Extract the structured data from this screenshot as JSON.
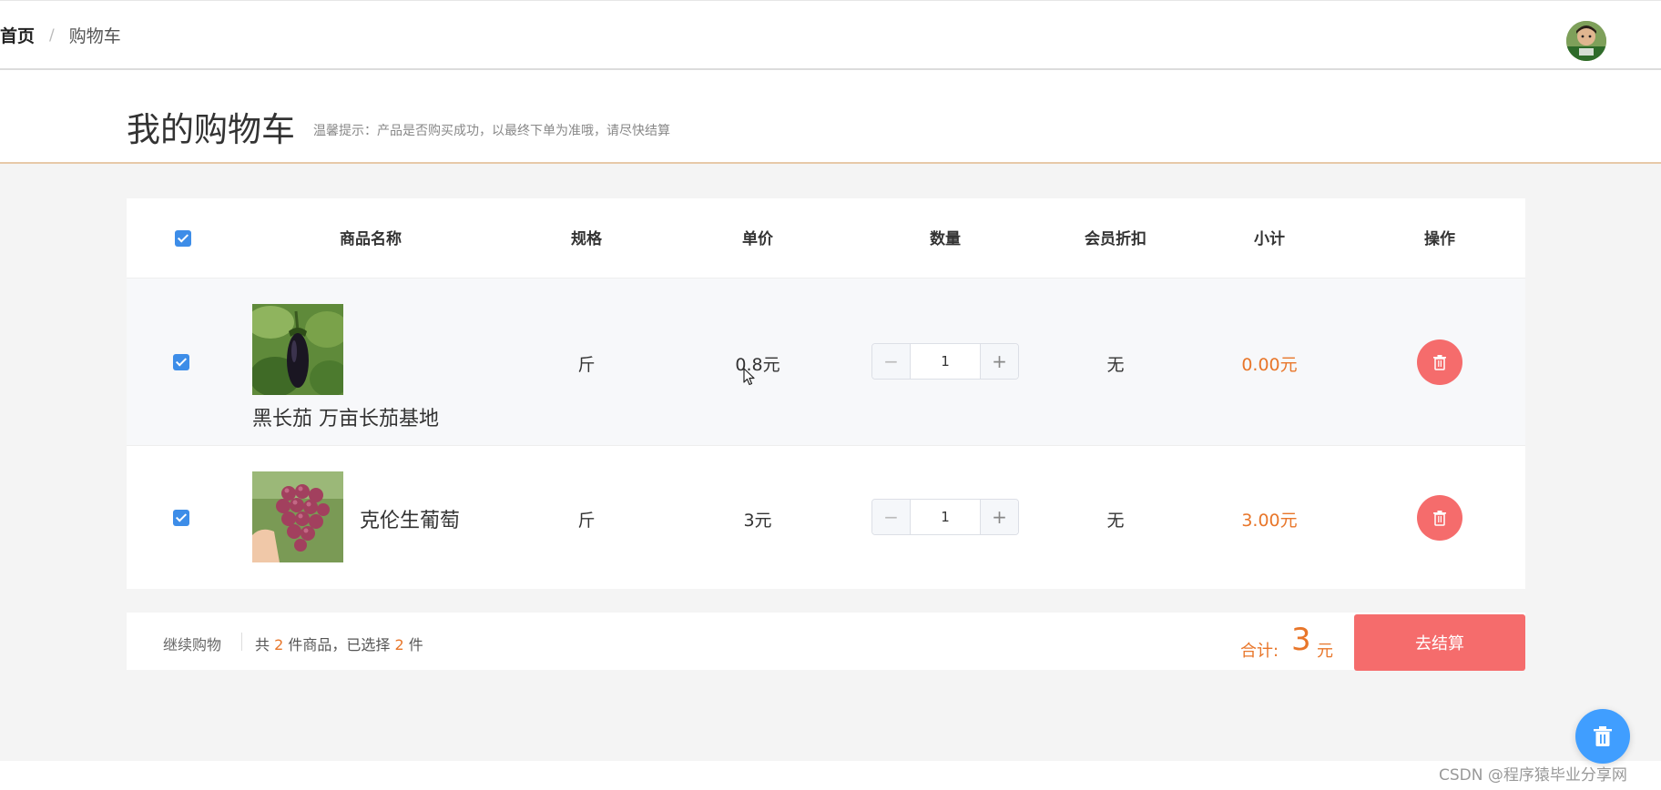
{
  "breadcrumb": {
    "home": "首页",
    "separator": "/",
    "current": "购物车"
  },
  "header": {
    "title": "我的购物车",
    "tip": "温馨提示：产品是否购买成功，以最终下单为准哦，请尽快结算"
  },
  "table": {
    "columns": [
      "商品名称",
      "规格",
      "单价",
      "数量",
      "会员折扣",
      "小计",
      "操作"
    ],
    "rows": [
      {
        "name": "黑长茄 万亩长茄基地",
        "spec": "斤",
        "price": "0.8元",
        "quantity": "1",
        "discount": "无",
        "subtotal": "0.00元",
        "checked": true
      },
      {
        "name": "克伦生葡萄",
        "spec": "斤",
        "price": "3元",
        "quantity": "1",
        "discount": "无",
        "subtotal": "3.00元",
        "checked": true
      }
    ]
  },
  "footer": {
    "continue": "继续购物",
    "summary_prefix": "共",
    "total_items": "2",
    "summary_mid": "件商品，已选择",
    "selected_items": "2",
    "summary_suffix": "件",
    "total_label": "合计:",
    "total_value": "3",
    "total_unit": "元",
    "checkout": "去结算"
  },
  "watermark": "CSDN @程序猿毕业分享网",
  "colors": {
    "accent_orange": "#e8762a",
    "danger": "#f56c6c",
    "primary": "#409eff",
    "checkbox": "#3d8de8"
  },
  "icons": {
    "delete": "trash-icon",
    "minus": "minus-icon",
    "plus": "plus-icon"
  }
}
